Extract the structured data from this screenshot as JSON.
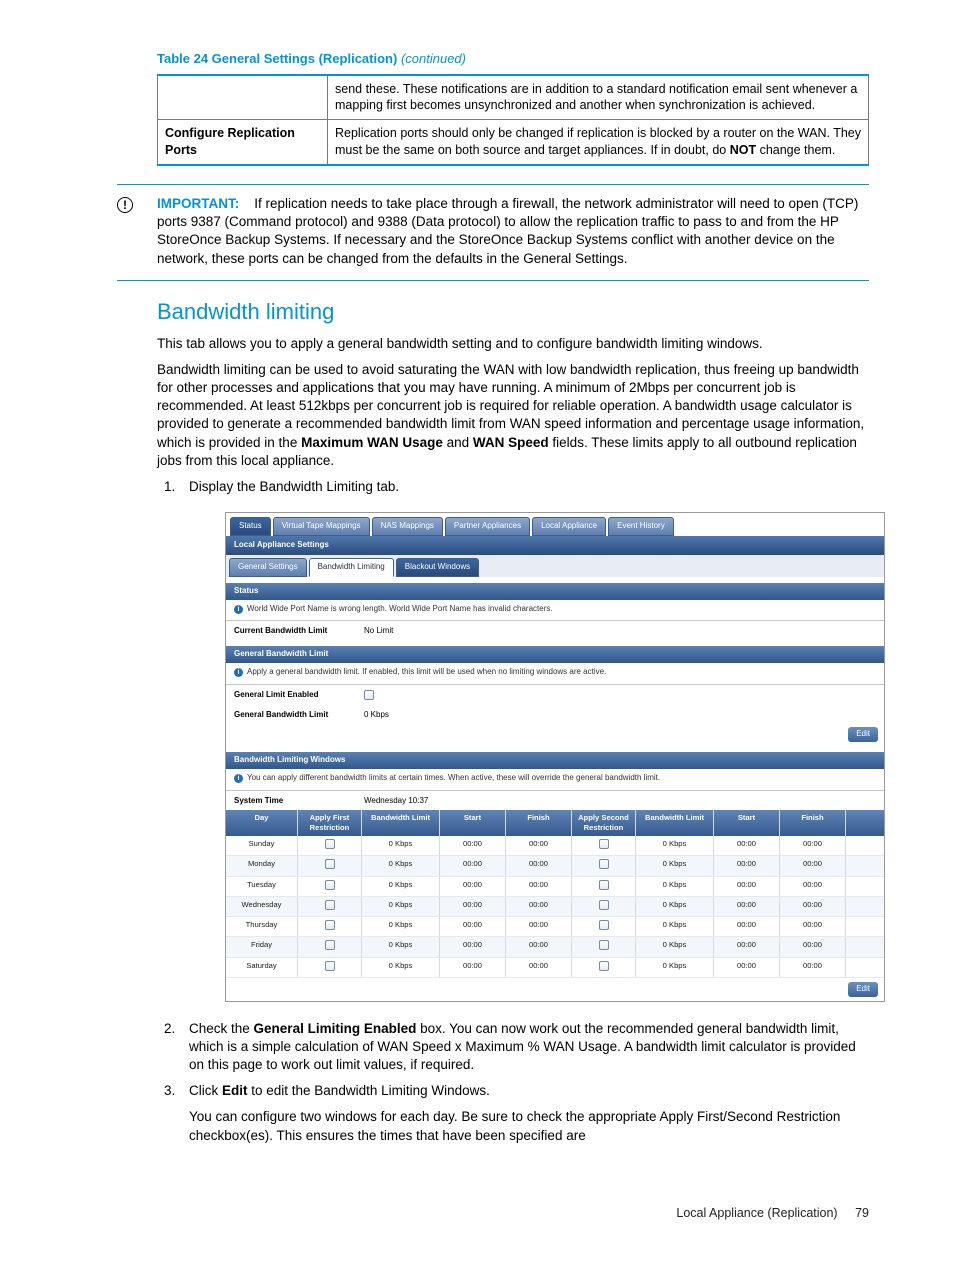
{
  "table": {
    "caption_prefix": "Table 24 General Settings (Replication)",
    "caption_suffix": "(continued)",
    "rows": [
      {
        "label": "",
        "text": "send these. These notifications are in addition to a standard notification email sent whenever a mapping first becomes unsynchronized and another when synchronization is achieved."
      },
      {
        "label": "Configure Replication Ports",
        "text": "Replication ports should only be changed if replication is blocked by a router on the WAN. They must be the same on both source and target appliances. If in doubt, do NOT change them."
      }
    ]
  },
  "important": {
    "label": "IMPORTANT:",
    "text_before": "If replication needs to take place through a firewall, the network administrator will need to open (TCP) ports 9387 (Command protocol) and 9388 (Data protocol) to allow the replication traffic to pass to and from the HP StoreOnce Backup Systems. If necessary and the StoreOnce Backup Systems conflict with another device on the network, these ports can be changed from the defaults in the General Settings."
  },
  "heading": "Bandwidth limiting",
  "para1": "This tab allows you to apply a general bandwidth setting and to configure bandwidth limiting windows.",
  "para2_a": "Bandwidth limiting can be used to avoid saturating the WAN with low bandwidth replication, thus freeing up bandwidth for other processes and applications that you may have running. A minimum of 2Mbps per concurrent job is recommended. At least 512kbps per concurrent job is required for reliable operation. A bandwidth usage calculator is provided to generate a recommended bandwidth limit from WAN speed information and percentage usage information, which is provided in the ",
  "para2_b1": "Maximum WAN Usage",
  "para2_mid": " and ",
  "para2_b2": "WAN Speed",
  "para2_c": " fields. These limits apply to all outbound replication jobs from this local appliance.",
  "steps": {
    "s1": "Display the Bandwidth Limiting tab.",
    "s2_a": "Check the ",
    "s2_b": "General Limiting Enabled",
    "s2_c": " box. You can now work out the recommended general bandwidth limit, which is a simple calculation of WAN Speed x Maximum % WAN Usage. A bandwidth limit calculator is provided on this page to work out limit values, if required.",
    "s3_a": "Click ",
    "s3_b": "Edit",
    "s3_c": " to edit the Bandwidth Limiting Windows.",
    "s3_p2": "You can configure two windows for each day. Be sure to check the appropriate Apply First/Second Restriction checkbox(es). This ensures the times that have been specified are"
  },
  "screenshot": {
    "tabs_top": [
      "Status",
      "Virtual Tape Mappings",
      "NAS Mappings",
      "Partner Appliances",
      "Local Appliance",
      "Event History"
    ],
    "band_header": "Local Appliance Settings",
    "subtabs": [
      "General Settings",
      "Bandwidth Limiting",
      "Blackout Windows"
    ],
    "sec_status": "Status",
    "status_msg": "World Wide Port Name is wrong length. World Wide Port Name has invalid characters.",
    "current_bw_label": "Current Bandwidth Limit",
    "current_bw_val": "No Limit",
    "sec_general": "General Bandwidth Limit",
    "general_info": "Apply a general bandwidth limit. If enabled, this limit will be used when no limiting windows are active.",
    "gen_enabled_label": "General Limit Enabled",
    "gen_bw_label": "General Bandwidth Limit",
    "gen_bw_val": "0 Kbps",
    "edit_btn": "Edit",
    "sec_windows": "Bandwidth Limiting Windows",
    "windows_info": "You can apply different bandwidth limits at certain times. When active, these will override the general bandwidth limit.",
    "systime_label": "System Time",
    "systime_val": "Wednesday 10:37",
    "grid_headers": [
      "Day",
      "Apply First Restriction",
      "Bandwidth Limit",
      "Start",
      "Finish",
      "Apply Second Restriction",
      "Bandwidth Limit",
      "Start",
      "Finish"
    ],
    "days": [
      "Sunday",
      "Monday",
      "Tuesday",
      "Wednesday",
      "Thursday",
      "Friday",
      "Saturday"
    ],
    "cell_bw": "0 Kbps",
    "cell_time": "00:00"
  },
  "footer": {
    "section": "Local Appliance (Replication)",
    "page": "79"
  }
}
